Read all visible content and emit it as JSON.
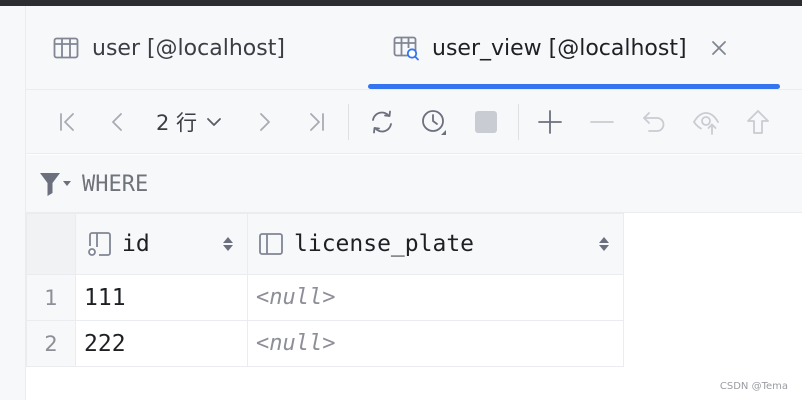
{
  "tabs": [
    {
      "label": "user [@localhost]",
      "icon": "table-icon",
      "active": false
    },
    {
      "label": "user_view [@localhost]",
      "icon": "view-icon",
      "active": true
    }
  ],
  "toolbar": {
    "rows_label": "2 行",
    "buttons": [
      "first-page",
      "previous-page",
      "next-page",
      "last-page",
      "reload",
      "history",
      "stop",
      "add-row",
      "delete-row",
      "revert",
      "preview-changes",
      "submit"
    ]
  },
  "filter": {
    "placeholder": "WHERE"
  },
  "table": {
    "columns": [
      {
        "name": "id",
        "icon": "key-column-icon"
      },
      {
        "name": "license_plate",
        "icon": "column-icon"
      }
    ],
    "rows": [
      {
        "num": "1",
        "id": "111",
        "license_plate": "<null>"
      },
      {
        "num": "2",
        "id": "222",
        "license_plate": "<null>"
      }
    ]
  },
  "watermark": "CSDN @Tema",
  "colors": {
    "accent": "#3574f0",
    "icon_gray": "#818594",
    "icon_disabled": "#c9ccd2",
    "null_text": "#8c8f96"
  }
}
